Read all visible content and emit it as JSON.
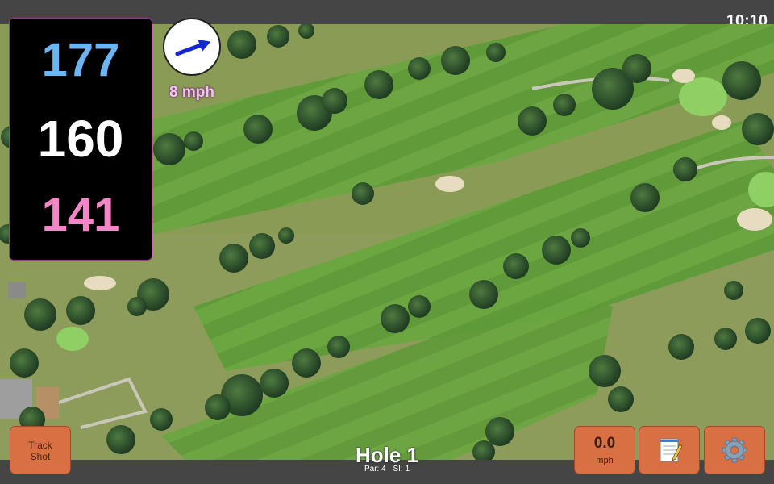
{
  "status_bar": {
    "clock": "10:10"
  },
  "distances": {
    "back": "177",
    "middle": "160",
    "front": "141"
  },
  "wind": {
    "speed_label": "8 mph",
    "button_value": "0.0",
    "button_unit": "mph"
  },
  "buttons": {
    "track_line1": "Track",
    "track_line2": "Shot"
  },
  "hole": {
    "title": "Hole 1",
    "par_label": "Par: 4",
    "si_label": "SI: 1"
  },
  "icons": {
    "wind": "arrow-icon",
    "notes": "notepad-icon",
    "settings": "gear-icon"
  },
  "colors": {
    "back": "#6bb6f2",
    "middle": "#ffffff",
    "front": "#f485c7",
    "button": "#d97044",
    "wind_arrow": "#1427d6"
  }
}
